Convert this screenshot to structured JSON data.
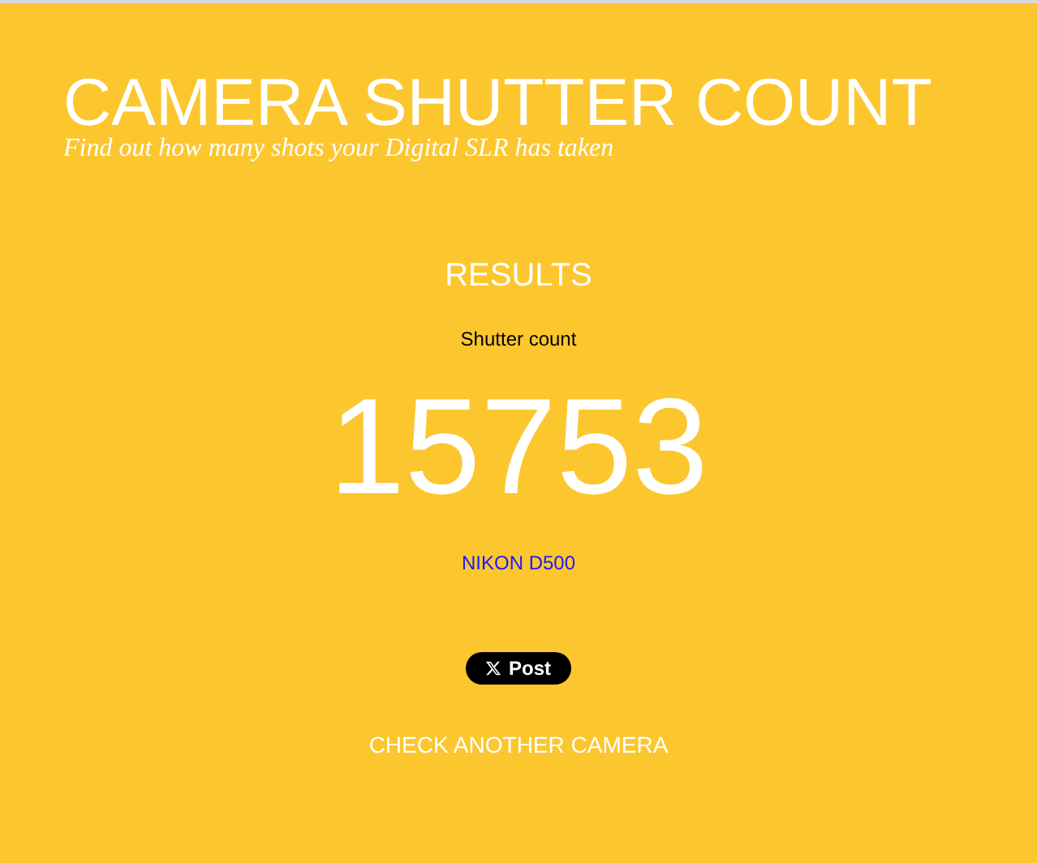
{
  "header": {
    "title": "CAMERA SHUTTER COUNT",
    "subtitle": "Find out how many shots your Digital SLR has taken"
  },
  "results": {
    "heading": "RESULTS",
    "label": "Shutter count",
    "count": "15753",
    "camera_link": "NIKON D500",
    "post_button": "Post",
    "check_another_link": "CHECK ANOTHER CAMERA"
  }
}
